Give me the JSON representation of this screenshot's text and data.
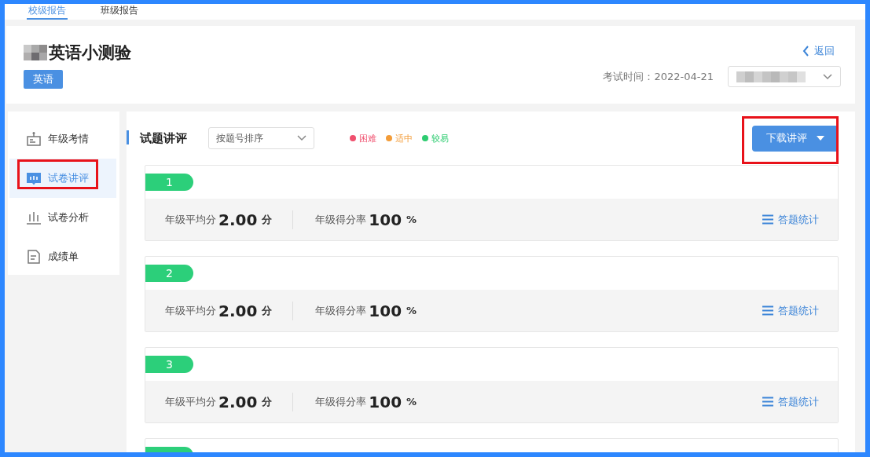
{
  "tabs": [
    {
      "label": "校级报告",
      "selected": true
    },
    {
      "label": "班级报告",
      "selected": false
    }
  ],
  "header": {
    "title": "英语小测验",
    "subject": "英语",
    "back": "返回",
    "exam_time_label": "考试时间：",
    "exam_time": "2022-04-21"
  },
  "sidebar": {
    "items": [
      {
        "label": "年级考情",
        "selected": false,
        "highlighted": false
      },
      {
        "label": "试卷讲评",
        "selected": true,
        "highlighted": true
      },
      {
        "label": "试卷分析",
        "selected": false,
        "highlighted": false
      },
      {
        "label": "成绩单",
        "selected": false,
        "highlighted": false
      }
    ]
  },
  "panel": {
    "title": "试题讲评",
    "sort": "按题号排序",
    "legend": [
      {
        "label": "困难",
        "color": "#f0506e"
      },
      {
        "label": "适中",
        "color": "#f39c38"
      },
      {
        "label": "较易",
        "color": "#2ecc71"
      }
    ],
    "download": {
      "label": "下载讲评",
      "highlighted": true
    }
  },
  "questions": [
    {
      "number": "1",
      "color": "#2ccf7a",
      "avg_label": "年级平均分",
      "avg": "2.00",
      "avg_unit": "分",
      "rate_label": "年级得分率",
      "rate": "100",
      "rate_unit": "%",
      "stats": "答题统计"
    },
    {
      "number": "2",
      "color": "#2ccf7a",
      "avg_label": "年级平均分",
      "avg": "2.00",
      "avg_unit": "分",
      "rate_label": "年级得分率",
      "rate": "100",
      "rate_unit": "%",
      "stats": "答题统计"
    },
    {
      "number": "3",
      "color": "#2ccf7a",
      "avg_label": "年级平均分",
      "avg": "2.00",
      "avg_unit": "分",
      "rate_label": "年级得分率",
      "rate": "100",
      "rate_unit": "%",
      "stats": "答题统计"
    },
    {
      "color": "#2ccf7a"
    }
  ]
}
